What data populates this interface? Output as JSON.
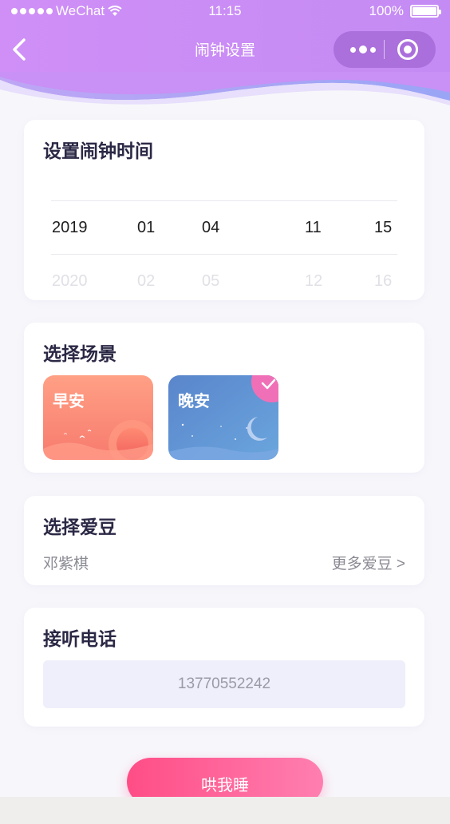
{
  "status_bar": {
    "carrier": "WeChat",
    "time": "11:15",
    "battery": "100%"
  },
  "nav": {
    "title": "闹钟设置",
    "back_icon": "chevron-left-icon",
    "more_icon": "more-dots-icon",
    "close_icon": "target-circle-icon"
  },
  "alarm_time": {
    "title": "设置闹钟时间",
    "selected": [
      "2019",
      "01",
      "04",
      "11",
      "15"
    ],
    "next": [
      "2020",
      "02",
      "05",
      "12",
      "16"
    ]
  },
  "scene": {
    "title": "选择场景",
    "options": [
      {
        "label": "早安",
        "selected": false
      },
      {
        "label": "晚安",
        "selected": true
      }
    ],
    "check_icon": "checkmark-icon"
  },
  "idol": {
    "title": "选择爱豆",
    "current": "邓紫棋",
    "more_label": "更多爱豆 >"
  },
  "phone_call": {
    "title": "接听电话",
    "number": "13770552242"
  },
  "action": {
    "label": "哄我睡"
  },
  "colors": {
    "header_purple": "#c78cf5",
    "accent_pink": "#ff4d86",
    "page_bg": "#f7f7fb"
  }
}
